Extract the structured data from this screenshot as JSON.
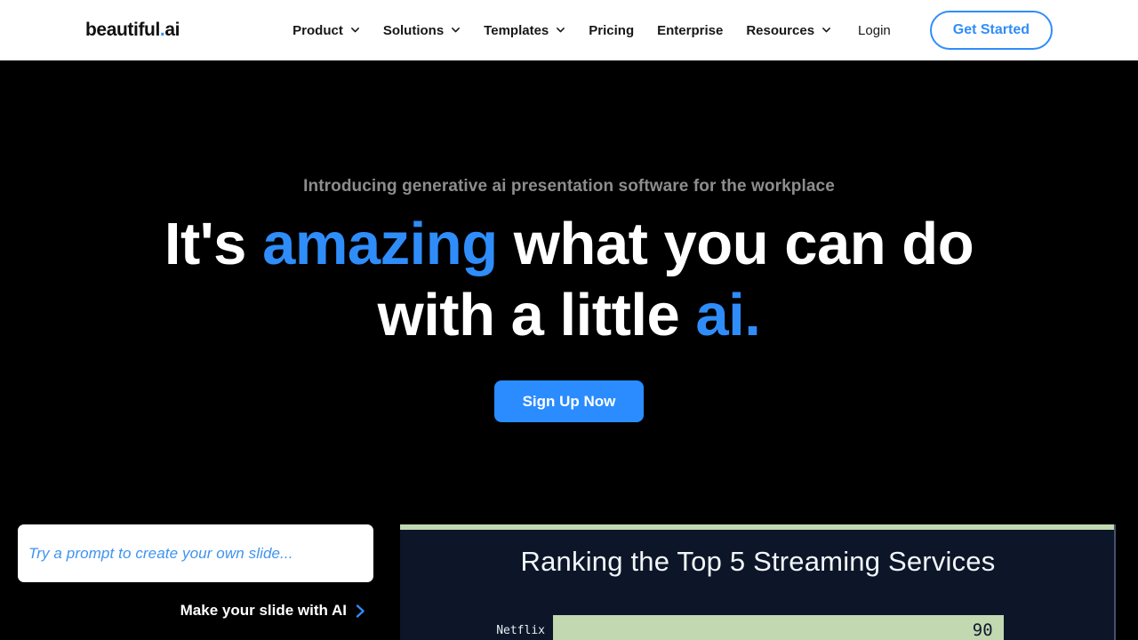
{
  "navbar": {
    "brand_name": "beautiful",
    "brand_dot": ".",
    "brand_suffix": "ai",
    "items": [
      {
        "label": "Product",
        "has_dropdown": true,
        "icon": "chevron-down-icon"
      },
      {
        "label": "Solutions",
        "has_dropdown": true,
        "icon": "chevron-down-icon"
      },
      {
        "label": "Templates",
        "has_dropdown": true,
        "icon": "chevron-down-icon"
      },
      {
        "label": "Pricing",
        "has_dropdown": false
      },
      {
        "label": "Enterprise",
        "has_dropdown": false
      },
      {
        "label": "Resources",
        "has_dropdown": true,
        "icon": "chevron-down-icon"
      }
    ],
    "login_label": "Login",
    "get_started_label": "Get Started",
    "background": "#ffffff",
    "text_color": "#15171a",
    "accent": "#2f8dfa"
  },
  "hero": {
    "eyebrow": "Introducing generative ai presentation software for the workplace",
    "title_part1": "It's",
    "title_accent1": "amazing",
    "title_part2": "what you can do with a little",
    "title_accent2": "ai",
    "title_period": ".",
    "cta_label": "Sign Up Now",
    "background": "#000000",
    "eyebrow_color": "#8d8d8d",
    "title_color": "#ffffff",
    "accent_color": "#2f8dfa",
    "cta_background": "#2a8cff"
  },
  "prompt": {
    "placeholder": "Try a prompt to create your own slide...",
    "value": "",
    "cta_label": "Make your slide with AI",
    "cta_icon": "chevron-right-icon",
    "box_background": "#ffffff",
    "placeholder_color": "#3d93f0"
  },
  "slide": {
    "title": "Ranking the Top 5 Streaming Services",
    "background": "#0c1628",
    "accent_color": "#c1d8b1",
    "title_color": "#f2f6fb",
    "chart_data": {
      "type": "bar",
      "title": "Ranking the Top 5 Streaming Services",
      "orientation": "horizontal",
      "categories": [
        "Netflix"
      ],
      "values": [
        90
      ],
      "value_labels": [
        "90"
      ],
      "xlabel": "",
      "ylabel": "",
      "xlim": [
        0,
        100
      ],
      "grid": false,
      "legend": "none",
      "bar_color": "#c1d8b1",
      "label_color": "#e8eef6",
      "value_color": "#10192b"
    }
  }
}
